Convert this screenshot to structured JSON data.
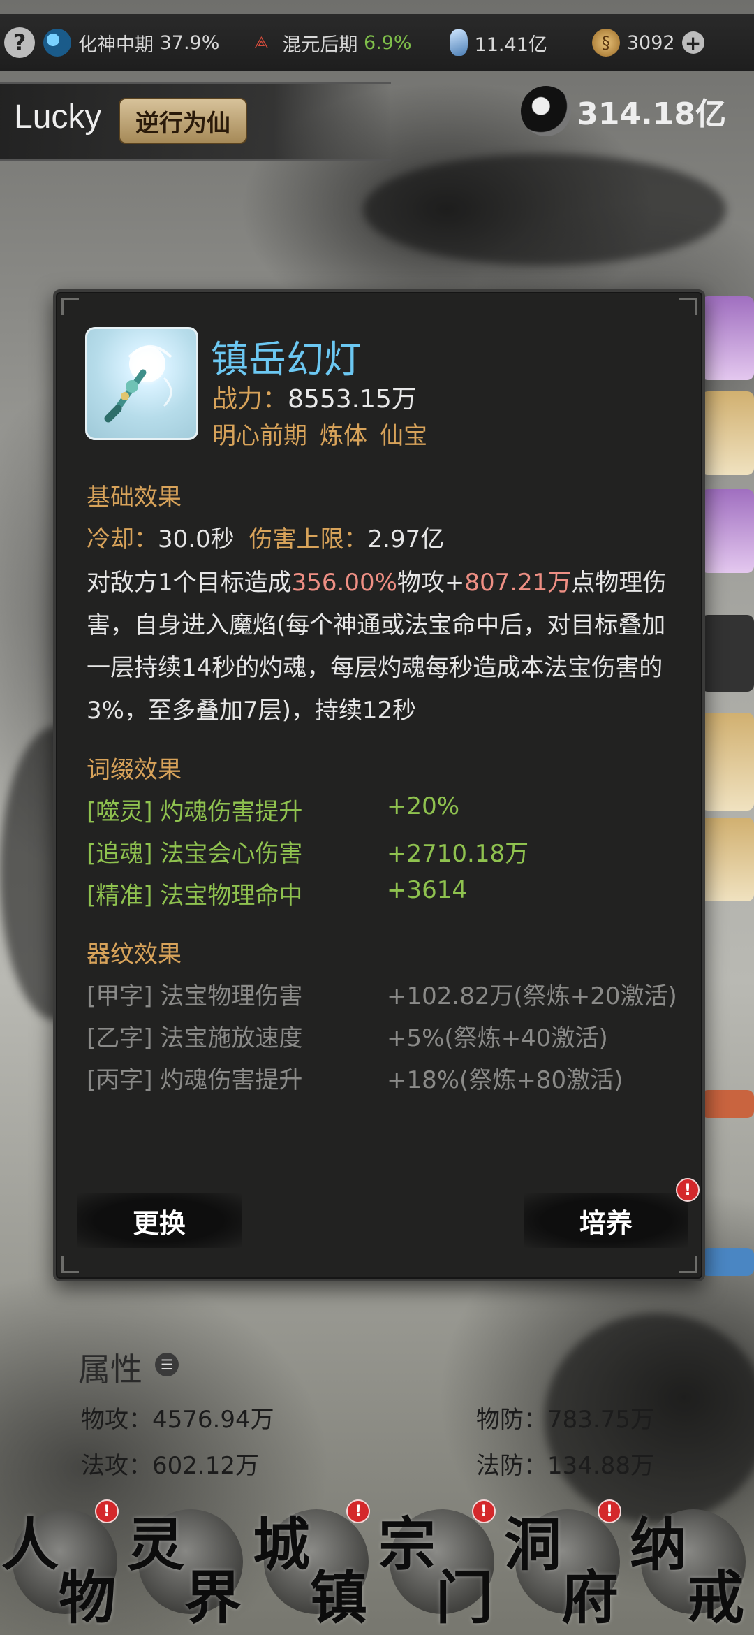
{
  "status_bar": {
    "help": "?",
    "realm1": {
      "name": "化神中期",
      "pct": "37.9%"
    },
    "realm2": {
      "name": "混元后期",
      "pct": "6.9%"
    },
    "crystals": "11.41亿",
    "coins": "3092"
  },
  "header": {
    "player_name": "Lucky",
    "title_badge": "逆行为仙",
    "total_power": "314.18亿"
  },
  "item": {
    "name": "镇岳幻灯",
    "power_label": "战力：",
    "power_value": "8553.15万",
    "tags": [
      "明心前期",
      "炼体",
      "仙宝"
    ]
  },
  "base_effect": {
    "title": "基础效果",
    "cooldown_label": "冷却：",
    "cooldown_value": "30.0秒",
    "cap_label": "伤害上限：",
    "cap_value": "2.97亿",
    "desc_prefix": "对敌方1个目标造成",
    "desc_pct": "356.00%",
    "desc_mid": "物攻+",
    "desc_flat": "807.21万",
    "desc_suffix": "点物理伤害，自身进入魔焰(每个神通或法宝命中后，对目标叠加一层持续14秒的灼魂，每层灼魂每秒造成本法宝伤害的3%，至多叠加7层)，持续12秒"
  },
  "affix_effect": {
    "title": "词缀效果",
    "items": [
      {
        "name": "[噬灵] 灼魂伤害提升",
        "value": "+20%"
      },
      {
        "name": "[追魂] 法宝会心伤害",
        "value": "+2710.18万"
      },
      {
        "name": "[精准] 法宝物理命中",
        "value": "+3614"
      }
    ]
  },
  "pattern_effect": {
    "title": "器纹效果",
    "items": [
      {
        "name": "[甲字] 法宝物理伤害",
        "value": "+102.82万(祭炼+20激活)"
      },
      {
        "name": "[乙字] 法宝施放速度",
        "value": "+5%(祭炼+40激活)"
      },
      {
        "name": "[丙字] 灼魂伤害提升",
        "value": "+18%(祭炼+80激活)"
      }
    ]
  },
  "buttons": {
    "swap": "更换",
    "train": "培养",
    "alert": "!"
  },
  "attributes": {
    "title": "属性",
    "phys_atk_label": "物攻：",
    "phys_atk": "4576.94万",
    "phys_def_label": "物防：",
    "phys_def": "783.75万",
    "mag_atk_label": "法攻：",
    "mag_atk": "602.12万",
    "mag_def_label": "法防：",
    "mag_def": "134.88万"
  },
  "nav": [
    {
      "c1": "人",
      "c2": "物",
      "alert": true
    },
    {
      "c1": "灵",
      "c2": "界",
      "alert": false
    },
    {
      "c1": "城",
      "c2": "镇",
      "alert": true
    },
    {
      "c1": "宗",
      "c2": "门",
      "alert": true
    },
    {
      "c1": "洞",
      "c2": "府",
      "alert": true
    },
    {
      "c1": "纳",
      "c2": "戒",
      "alert": false
    }
  ],
  "colors": {
    "accent_gold": "#d8a35a",
    "item_blue": "#6cc8f2",
    "affix_green": "#8fc24f",
    "highlight_pink": "#ee8f84"
  }
}
